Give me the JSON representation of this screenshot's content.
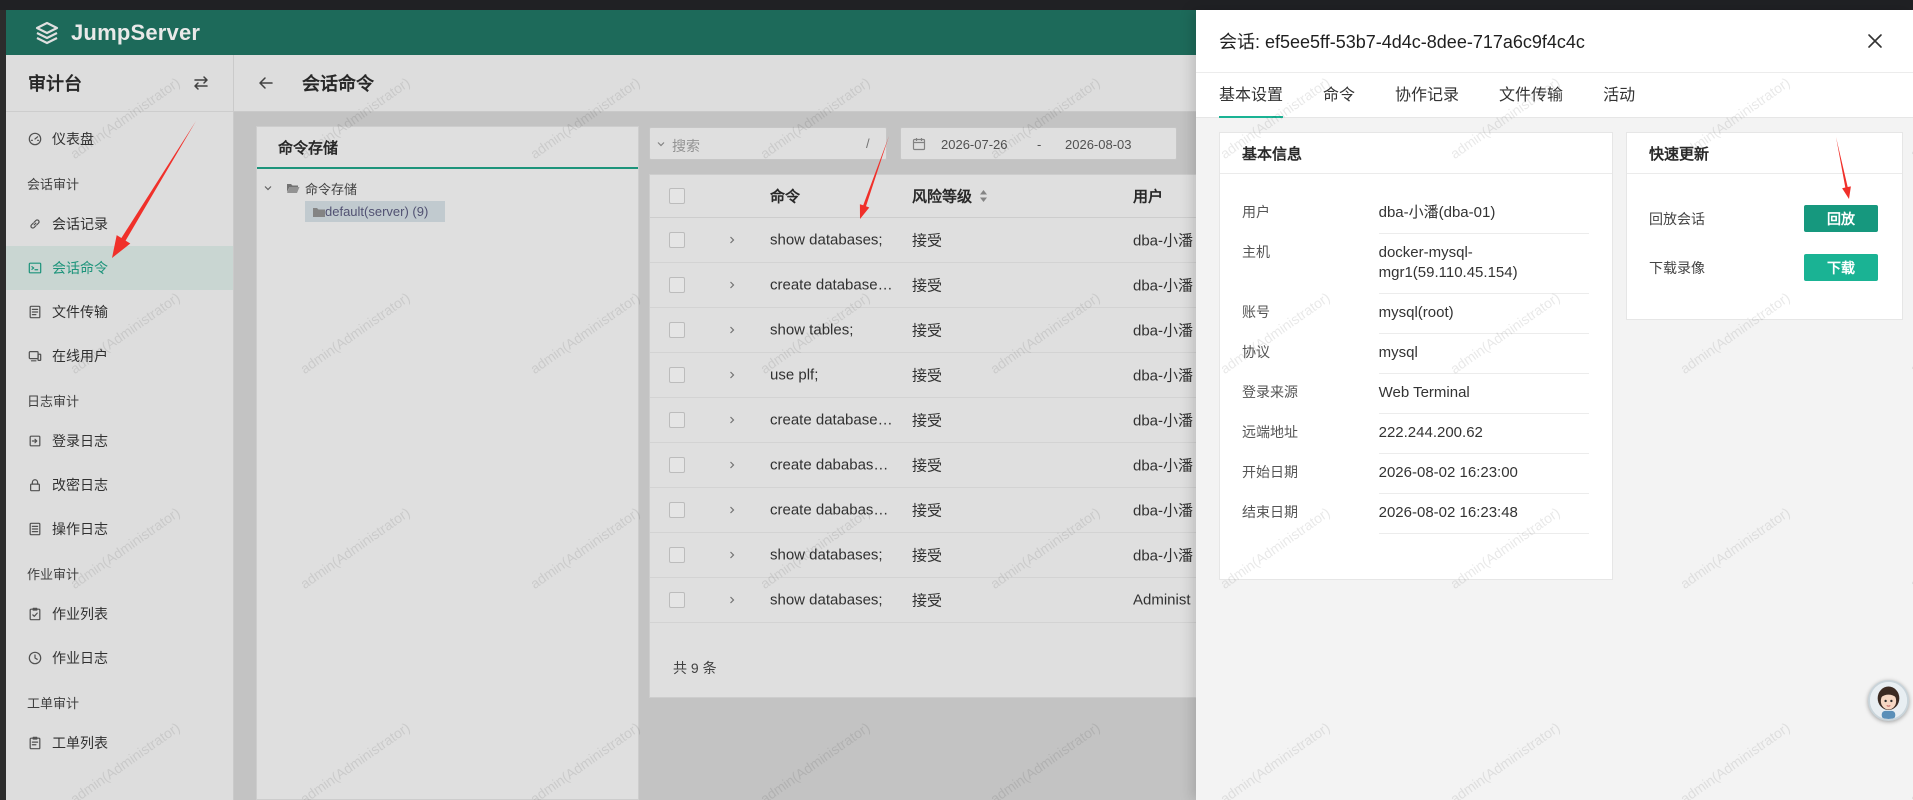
{
  "colors": {
    "brand": "#1ab394",
    "header": "#1f6f5e",
    "button_replay": "#16987e",
    "button_download": "#1ab394",
    "annotation": "#f0302a"
  },
  "app": {
    "logo_text": "JumpServer",
    "logo_icon": "jumpserver-logo-icon"
  },
  "sidebar": {
    "title": "审计台",
    "switch_icon": "swap-icon",
    "nav": [
      {
        "type": "item",
        "label": "仪表盘",
        "icon": "dashboard-icon"
      },
      {
        "type": "section",
        "label": "会话审计"
      },
      {
        "type": "item",
        "label": "会话记录",
        "icon": "link-icon"
      },
      {
        "type": "item",
        "label": "会话命令",
        "icon": "terminal-icon",
        "active": true
      },
      {
        "type": "item",
        "label": "文件传输",
        "icon": "file-transfer-icon"
      },
      {
        "type": "item",
        "label": "在线用户",
        "icon": "online-user-icon"
      },
      {
        "type": "section",
        "label": "日志审计"
      },
      {
        "type": "item",
        "label": "登录日志",
        "icon": "login-icon"
      },
      {
        "type": "item",
        "label": "改密日志",
        "icon": "lock-icon"
      },
      {
        "type": "item",
        "label": "操作日志",
        "icon": "operation-log-icon"
      },
      {
        "type": "section",
        "label": "作业审计"
      },
      {
        "type": "item",
        "label": "作业列表",
        "icon": "job-list-icon"
      },
      {
        "type": "item",
        "label": "作业日志",
        "icon": "clock-icon"
      },
      {
        "type": "section",
        "label": "工单审计"
      },
      {
        "type": "item",
        "label": "工单列表",
        "icon": "ticket-icon"
      }
    ]
  },
  "page": {
    "title": "会话命令",
    "back_icon": "arrow-left-icon"
  },
  "storage_panel": {
    "tab": "命令存储",
    "tree": {
      "root": "命令存储",
      "children": [
        "default(server) (9)"
      ],
      "selected": "default(server) (9)"
    }
  },
  "toolbar": {
    "search_placeholder": "搜索",
    "search_shortcut": "/",
    "date_start": "2026-07-26",
    "date_separator": "-",
    "date_end": "2026-08-03"
  },
  "table": {
    "columns": {
      "command": "命令",
      "risk_level": "风险等级",
      "user": "用户"
    },
    "rows": [
      {
        "command": "show databases;",
        "risk": "接受",
        "user": "dba-小潘"
      },
      {
        "command": "create database…",
        "risk": "接受",
        "user": "dba-小潘"
      },
      {
        "command": "show tables;",
        "risk": "接受",
        "user": "dba-小潘"
      },
      {
        "command": "use plf;",
        "risk": "接受",
        "user": "dba-小潘"
      },
      {
        "command": "create database…",
        "risk": "接受",
        "user": "dba-小潘"
      },
      {
        "command": "create dababas…",
        "risk": "接受",
        "user": "dba-小潘"
      },
      {
        "command": "create dababas…",
        "risk": "接受",
        "user": "dba-小潘"
      },
      {
        "command": "show databases;",
        "risk": "接受",
        "user": "dba-小潘"
      },
      {
        "command": "show databases;",
        "risk": "接受",
        "user": "Administ"
      }
    ],
    "footer": "共 9 条"
  },
  "drawer": {
    "title": "会话: ef5ee5ff-53b7-4d4c-8dee-717a6c9f4c4c",
    "close_icon": "close-icon",
    "tabs": [
      "基本设置",
      "命令",
      "协作记录",
      "文件传输",
      "活动"
    ],
    "active_tab": "基本设置",
    "basic_info": {
      "title": "基本信息",
      "rows": [
        {
          "label": "用户",
          "value": "dba-小潘(dba-01)"
        },
        {
          "label": "主机",
          "value": "docker-mysql-mgr1(59.110.45.154)"
        },
        {
          "label": "账号",
          "value": "mysql(root)"
        },
        {
          "label": "协议",
          "value": "mysql"
        },
        {
          "label": "登录来源",
          "value": "Web Terminal"
        },
        {
          "label": "远端地址",
          "value": "222.244.200.62"
        },
        {
          "label": "开始日期",
          "value": "2026-08-02 16:23:00"
        },
        {
          "label": "结束日期",
          "value": "2026-08-02 16:23:48"
        }
      ]
    },
    "quick_update": {
      "title": "快速更新",
      "rows": [
        {
          "label": "回放会话",
          "button": "回放",
          "color_key": "button_replay"
        },
        {
          "label": "下载录像",
          "button": "下载",
          "color_key": "button_download"
        }
      ]
    }
  },
  "assistant": {
    "icon": "assistant-avatar-icon"
  },
  "watermark": {
    "text": "admin(Administrator)"
  }
}
